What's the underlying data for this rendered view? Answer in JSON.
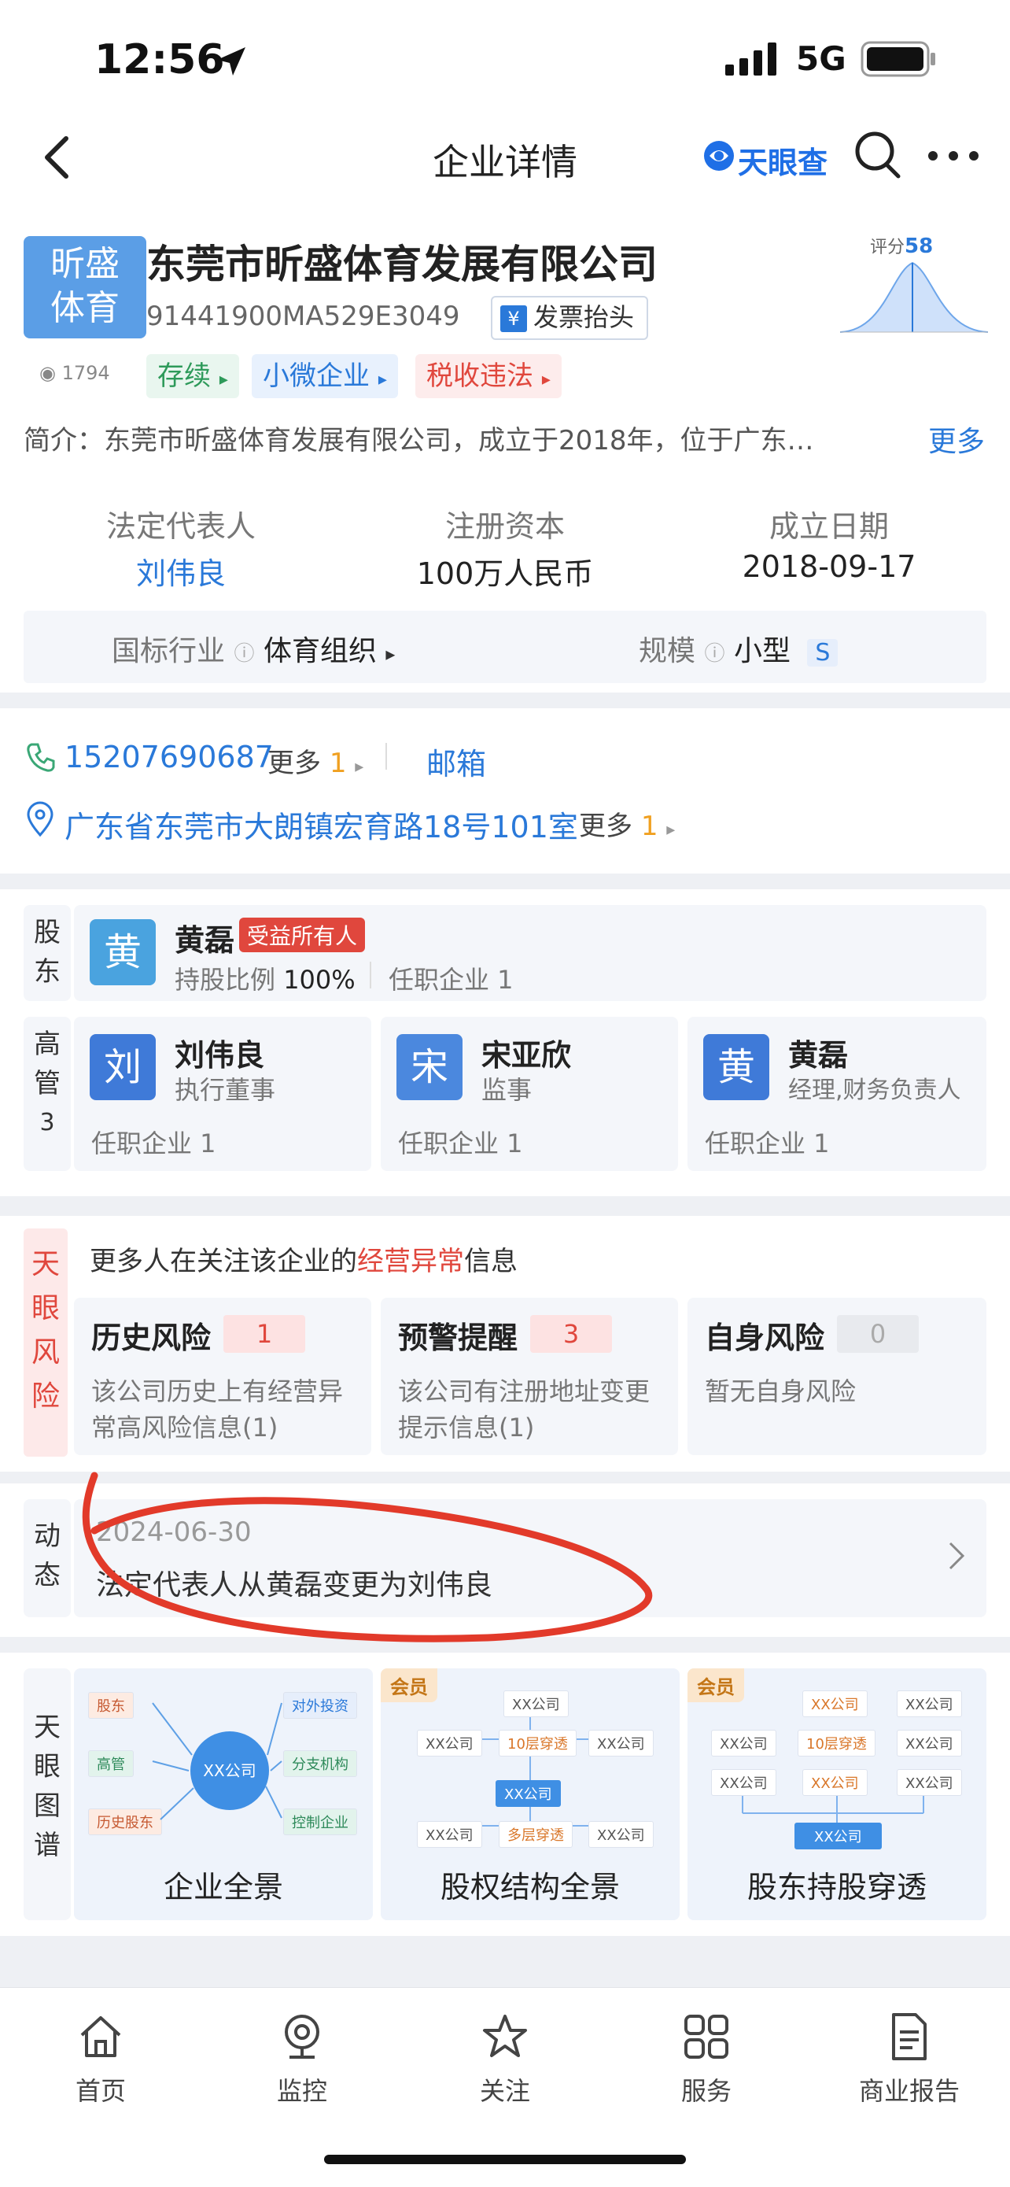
{
  "status_bar": {
    "time": "12:56",
    "network": "5G"
  },
  "nav": {
    "title": "企业详情",
    "brand": "天眼查"
  },
  "company": {
    "logo_line1": "昕盛",
    "logo_line2": "体育",
    "name": "东莞市昕盛体育发展有限公司",
    "credit_code": "91441900MA529E3049",
    "invoice_btn": "发票抬头",
    "views": "1794",
    "score_label": "评分",
    "score": "58",
    "tags": [
      "存续",
      "小微企业",
      "税收违法"
    ],
    "intro": "简介：东莞市昕盛体育发展有限公司，成立于2018年，位于广东…",
    "intro_more": "更多",
    "legal_rep_label": "法定代表人",
    "legal_rep": "刘伟良",
    "capital_label": "注册资本",
    "capital": "100万人民币",
    "founded_label": "成立日期",
    "founded": "2018-09-17",
    "industry_label": "国标行业",
    "industry": "体育组织",
    "scale_label": "规模",
    "scale": "小型",
    "scale_badge": "S"
  },
  "contact": {
    "phone": "15207690687",
    "phone_more": "更多",
    "phone_more_count": "1",
    "email": "邮箱",
    "address": "广东省东莞市大朗镇宏育路18号101室",
    "address_more": "更多",
    "address_more_count": "1"
  },
  "shareholders": {
    "label": "股东",
    "name": "黄磊",
    "avatar": "黄",
    "badge": "受益所有人",
    "ratio_label": "持股比例",
    "ratio": "100%",
    "jobs": "任职企业 1"
  },
  "executives": {
    "label": "高管",
    "count": "3",
    "items": [
      {
        "avatar": "刘",
        "name": "刘伟良",
        "role": "执行董事",
        "jobs": "任职企业 1"
      },
      {
        "avatar": "宋",
        "name": "宋亚欣",
        "role": "监事",
        "jobs": "任职企业 1"
      },
      {
        "avatar": "黄",
        "name": "黄磊",
        "role": "经理,财务负责人",
        "jobs": "任职企业 1"
      }
    ]
  },
  "risk": {
    "side_label": "天眼风险",
    "headline_pre": "更多人在关注该企业的",
    "headline_em": "经营异常",
    "headline_post": "信息",
    "cards": [
      {
        "title": "历史风险",
        "count": "1",
        "desc1": "该公司历史上有经营异",
        "desc2": "常高风险信息(1)"
      },
      {
        "title": "预警提醒",
        "count": "3",
        "desc1": "该公司有注册地址变更",
        "desc2": "提示信息(1)"
      },
      {
        "title": "自身风险",
        "count": "0",
        "desc1": "暂无自身风险",
        "desc2": ""
      }
    ]
  },
  "dynamics": {
    "label": "动态",
    "date": "2024-06-30",
    "text": "法定代表人从黄磊变更为刘伟良"
  },
  "graph": {
    "side_label": "天眼图谱",
    "cards": [
      {
        "title": "企业全景",
        "vip": ""
      },
      {
        "title": "股权结构全景",
        "vip": "会员"
      },
      {
        "title": "股东持股穿透",
        "vip": "会员"
      }
    ],
    "panorama": {
      "center": "XX公司",
      "left": [
        "股东",
        "高管",
        "历史股东"
      ],
      "right": [
        "对外投资",
        "分支机构",
        "控制企业"
      ]
    },
    "mini_company": "XX公司",
    "mini_layer": "10层穿透",
    "mini_multi": "多层穿透"
  },
  "tabbar": {
    "items": [
      "首页",
      "监控",
      "关注",
      "服务",
      "商业报告"
    ]
  },
  "colors": {
    "accent": "#2a79d9",
    "danger": "#e0473d",
    "annotation": "#e23a2a"
  }
}
